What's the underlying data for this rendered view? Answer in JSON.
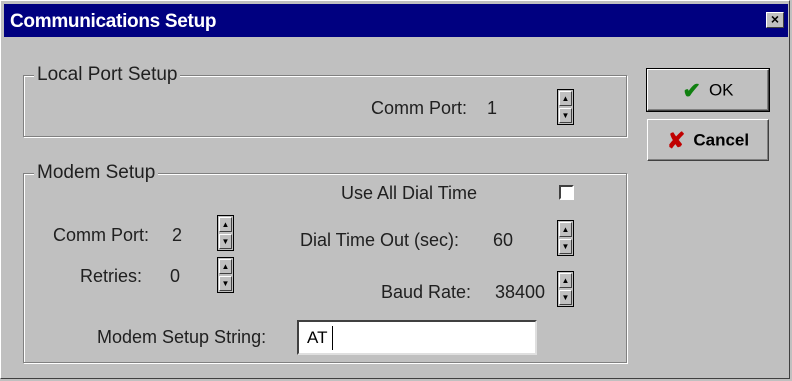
{
  "window": {
    "title": "Communications Setup",
    "close_glyph": "×"
  },
  "local_port": {
    "group_label": "Local Port Setup",
    "comm_port_label": "Comm Port:",
    "comm_port_value": "1"
  },
  "modem": {
    "group_label": "Modem Setup",
    "comm_port_label": "Comm Port:",
    "comm_port_value": "2",
    "retries_label": "Retries:",
    "retries_value": "0",
    "use_all_dial_time_label": "Use All Dial Time",
    "use_all_dial_time_checked": false,
    "dial_timeout_label": "Dial Time Out (sec):",
    "dial_timeout_value": "60",
    "baud_rate_label": "Baud Rate:",
    "baud_rate_value": "38400",
    "setup_string_label": "Modem Setup String:",
    "setup_string_value": "AT"
  },
  "buttons": {
    "ok_label": "OK",
    "ok_icon": "checkmark-icon",
    "cancel_label": "Cancel",
    "cancel_icon": "x-icon"
  }
}
